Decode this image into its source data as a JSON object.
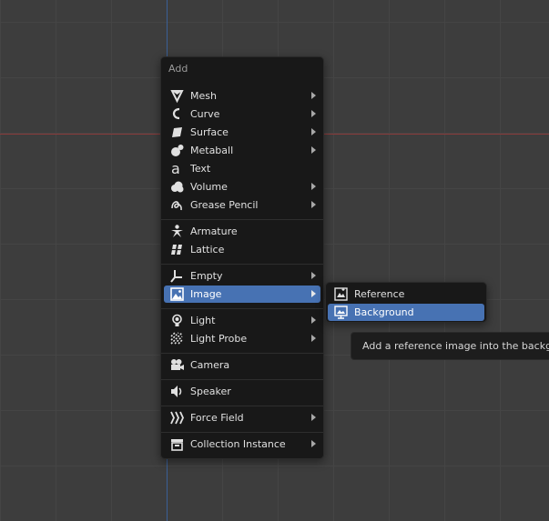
{
  "menu": {
    "title": "Add",
    "items": [
      {
        "label": "Mesh",
        "icon": "mesh-icon",
        "submenu": true
      },
      {
        "label": "Curve",
        "icon": "curve-icon",
        "submenu": true
      },
      {
        "label": "Surface",
        "icon": "surface-icon",
        "submenu": true
      },
      {
        "label": "Metaball",
        "icon": "metaball-icon",
        "submenu": true
      },
      {
        "label": "Text",
        "icon": "text-icon",
        "submenu": false
      },
      {
        "label": "Volume",
        "icon": "volume-icon",
        "submenu": true
      },
      {
        "label": "Grease Pencil",
        "icon": "grease-pencil-icon",
        "submenu": true
      },
      {
        "label": "Armature",
        "icon": "armature-icon",
        "submenu": false
      },
      {
        "label": "Lattice",
        "icon": "lattice-icon",
        "submenu": false
      },
      {
        "label": "Empty",
        "icon": "empty-icon",
        "submenu": true
      },
      {
        "label": "Image",
        "icon": "image-icon",
        "submenu": true
      },
      {
        "label": "Light",
        "icon": "light-icon",
        "submenu": true
      },
      {
        "label": "Light Probe",
        "icon": "light-probe-icon",
        "submenu": true
      },
      {
        "label": "Camera",
        "icon": "camera-icon",
        "submenu": false
      },
      {
        "label": "Speaker",
        "icon": "speaker-icon",
        "submenu": false
      },
      {
        "label": "Force Field",
        "icon": "force-field-icon",
        "submenu": true
      },
      {
        "label": "Collection Instance",
        "icon": "collection-instance-icon",
        "submenu": true
      }
    ]
  },
  "submenu": {
    "items": [
      {
        "label": "Reference",
        "icon": "reference-image-icon"
      },
      {
        "label": "Background",
        "icon": "background-image-icon"
      }
    ]
  },
  "tooltip": {
    "text": "Add a reference image into the background"
  },
  "colors": {
    "highlight": "#4772b3",
    "menu_bg": "#181818",
    "viewport_bg": "#3d3d3d",
    "x_axis": "#8a3a3a",
    "y_axis": "#3a5f96"
  }
}
